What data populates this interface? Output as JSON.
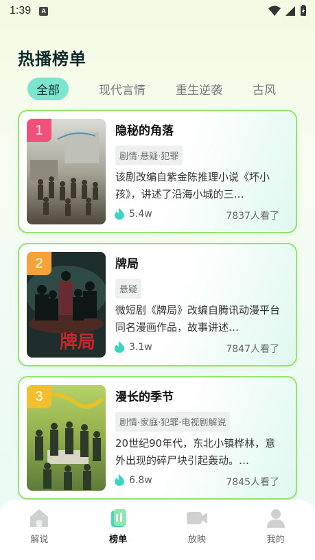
{
  "status_bar": {
    "time": "1:39",
    "notif_letter": "A"
  },
  "page_title": "热播榜单",
  "tabs": [
    {
      "label": "全部",
      "active": true
    },
    {
      "label": "现代言情",
      "active": false
    },
    {
      "label": "重生逆袭",
      "active": false
    },
    {
      "label": "古风",
      "active": false
    }
  ],
  "cards": [
    {
      "rank": "1",
      "rank_color": "#f24f7a",
      "title": "隐秘的角落",
      "tags": "剧情·悬疑·犯罪",
      "desc": "该剧改编自紫金陈推理小说《坏小孩》，讲述了沿海小城的三…",
      "likes": "5.4w",
      "views": "7837人看了"
    },
    {
      "rank": "2",
      "rank_color": "#f6a13a",
      "title": "牌局",
      "tags": "悬疑",
      "desc": "微短剧《牌局》改编自腾讯动漫平台同名漫画作品，故事讲述…",
      "likes": "3.1w",
      "views": "7847人看了"
    },
    {
      "rank": "3",
      "rank_color": "#f4be2c",
      "title": "漫长的季节",
      "tags": "剧情·家庭·犯罪·电视剧解说",
      "desc": "20世纪90年代，东北小镇桦林，意外出现的碎尸块引起轰动。…",
      "likes": "6.8w",
      "views": "7845人看了"
    }
  ],
  "bottom_nav": [
    {
      "label": "解说",
      "icon": "home-icon",
      "active": false
    },
    {
      "label": "榜单",
      "icon": "ranking-icon",
      "active": true
    },
    {
      "label": "放映",
      "icon": "video-camera-icon",
      "active": false
    },
    {
      "label": "我的",
      "icon": "profile-icon",
      "active": false
    }
  ],
  "colors": {
    "accent": "#7ce5cf",
    "card_border": "#93e565",
    "like_icon": "#3cd6c0"
  }
}
